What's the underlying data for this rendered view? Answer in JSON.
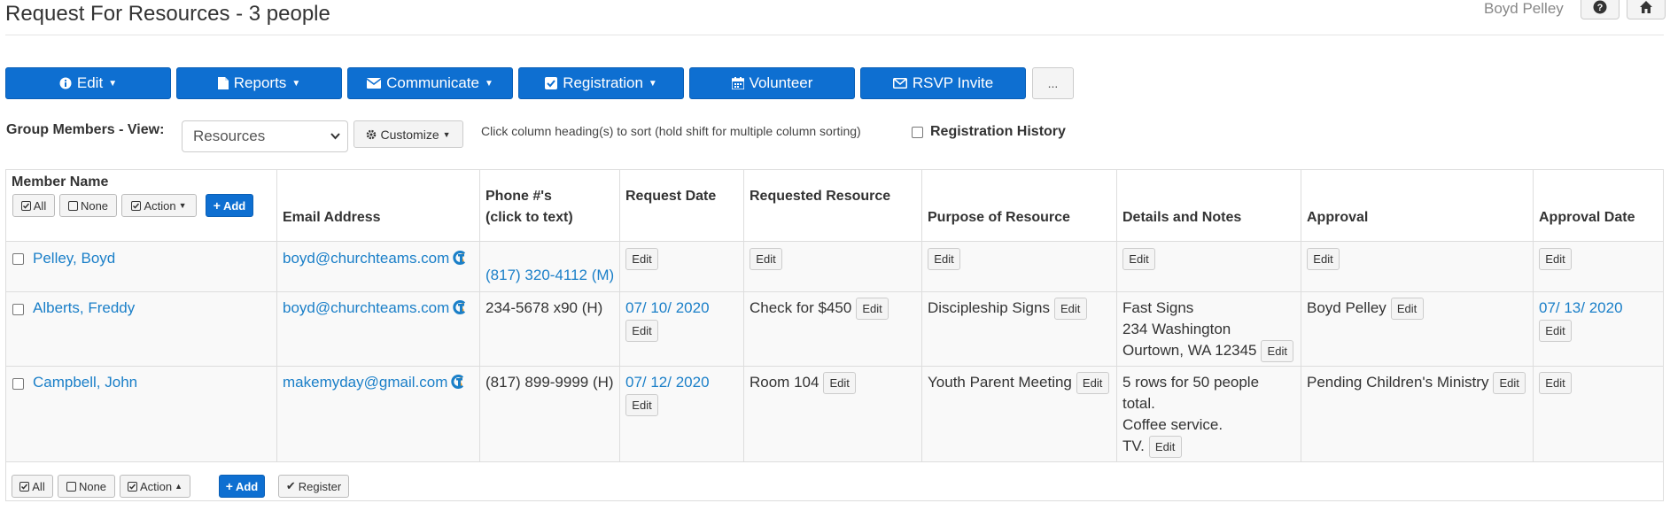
{
  "header": {
    "title": "Request For Resources - 3 people",
    "user": "Boyd Pelley"
  },
  "toolbar": {
    "edit": "Edit",
    "reports": "Reports",
    "communicate": "Communicate",
    "registration": "Registration",
    "volunteer": "Volunteer",
    "rsvp": "RSVP Invite",
    "more": "..."
  },
  "view": {
    "label": "Group Members - View:",
    "selected": "Resources",
    "customize": "Customize",
    "sort_hint": "Click column heading(s) to sort (hold shift for multiple column sorting)",
    "reg_history": "Registration History"
  },
  "table": {
    "member_header": "Member Name",
    "controls": {
      "all": "All",
      "none": "None",
      "action": "Action",
      "add": "Add",
      "register": "Register"
    },
    "headers": {
      "email": "Email Address",
      "phone1": "Phone #'s",
      "phone2": "(click to text)",
      "request_date": "Request Date",
      "resource": "Requested Resource",
      "purpose": "Purpose of Resource",
      "details": "Details and Notes",
      "approval": "Approval",
      "approval_date": "Approval Date"
    },
    "edit_label": "Edit",
    "rows": [
      {
        "name": "Pelley, Boyd",
        "email": "boyd@churchteams.com",
        "phone": "(817) 320-4112 (M)",
        "request_date": "",
        "resource": "",
        "purpose": "",
        "details": [],
        "approval": "",
        "approval_date": ""
      },
      {
        "name": "Alberts, Freddy",
        "email": "boyd@churchteams.com",
        "phone": "234-5678 x90 (H)",
        "request_date": "07/ 10/ 2020",
        "resource": "Check for $450",
        "purpose": "Discipleship Signs",
        "details": [
          "Fast Signs",
          "234 Washington",
          "Ourtown, WA 12345"
        ],
        "approval": "Boyd Pelley",
        "approval_date": "07/ 13/ 2020"
      },
      {
        "name": "Campbell, John",
        "email": "makemyday@gmail.com",
        "phone": "(817) 899-9999 (H)",
        "request_date": "07/ 12/ 2020",
        "resource": "Room 104",
        "purpose": "Youth Parent Meeting",
        "details": [
          "5 rows for 50 people",
          "total.",
          "Coffee service.",
          "TV."
        ],
        "approval": "Pending Children's Ministry",
        "approval_date": ""
      }
    ]
  },
  "colors": {
    "primary": "#0e6fd1",
    "link": "#1a7fc8",
    "border": "#dddddd"
  }
}
